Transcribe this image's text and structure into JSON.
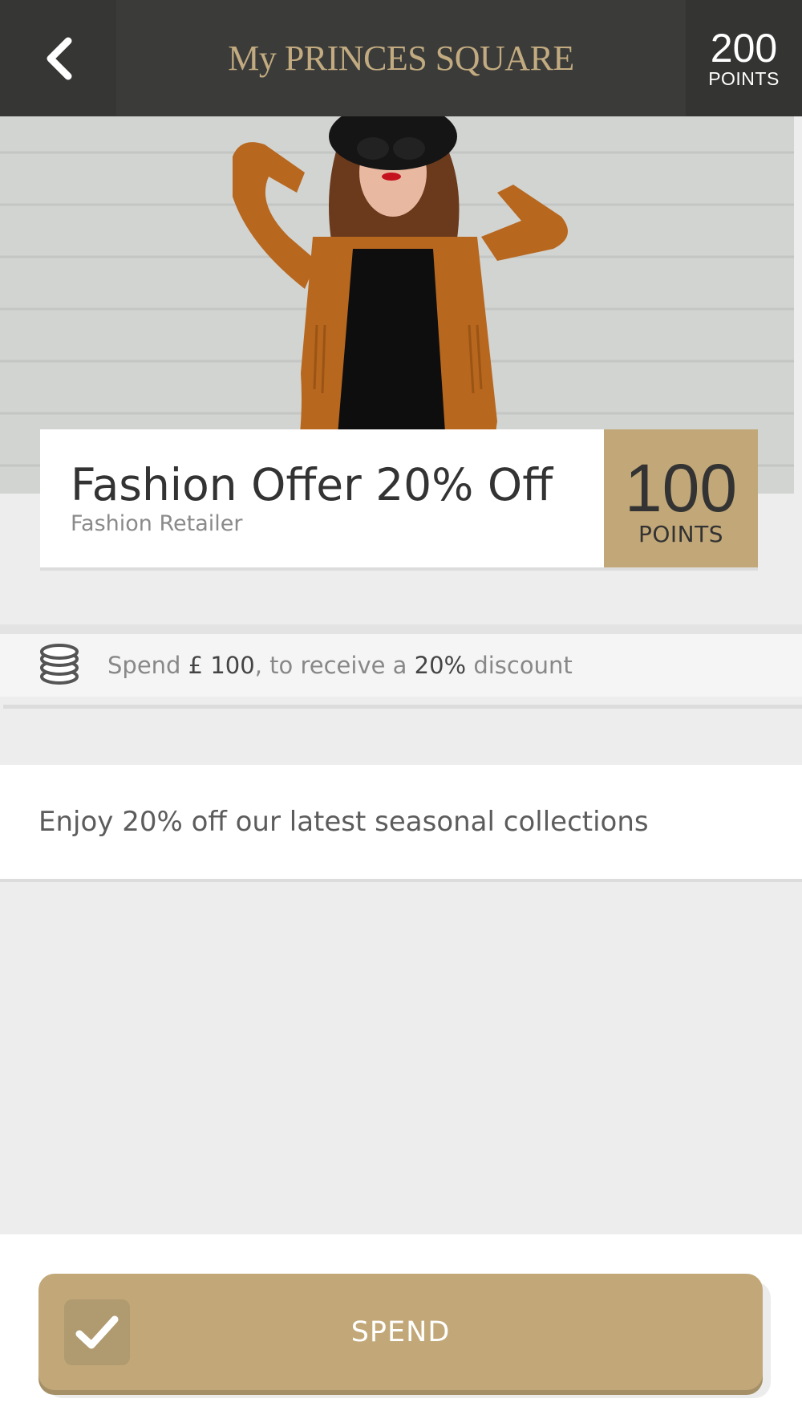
{
  "header": {
    "back_icon": "chevron-left-icon",
    "brand": "My PRINCES SQUARE",
    "points_value": "200",
    "points_label": "POINTS"
  },
  "hero": {
    "image": "woman-in-suede-fringe-jacket-photo"
  },
  "offer": {
    "title": "Fashion Offer 20% Off",
    "retailer": "Fashion Retailer",
    "points_value": "100",
    "points_label": "POINTS"
  },
  "spend_info": {
    "icon": "coins-icon",
    "prefix": "Spend ",
    "amount": "£ 100",
    "middle": ", to receive a ",
    "discount": "20%",
    "suffix": " discount"
  },
  "description": "Enjoy 20% off our latest seasonal collections",
  "action": {
    "icon": "check-icon",
    "label": "SPEND"
  },
  "colors": {
    "header_bg": "#3b3b39",
    "brand_gold": "#c2ab80",
    "accent_tan": "#c2a878",
    "page_bg": "#ededed"
  }
}
